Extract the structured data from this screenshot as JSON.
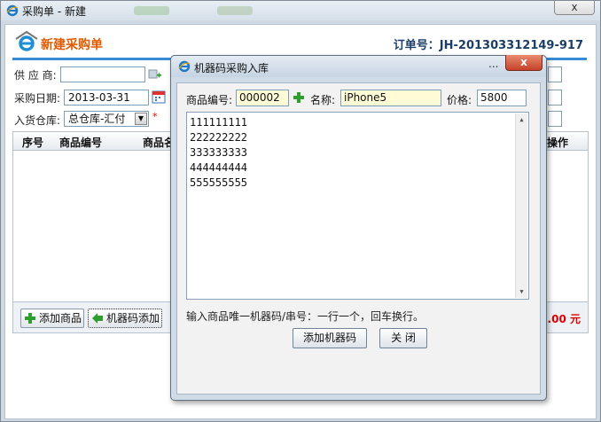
{
  "window": {
    "title": "采购单 - 新建",
    "close_glyph": "x"
  },
  "header": {
    "title": "新建采购单",
    "order_label": "订单号：JH-201303312149-917"
  },
  "form": {
    "supplier_label": "供 应 商:",
    "supplier_value": "",
    "date_label": "采购日期:",
    "date_value": "2013-03-31",
    "warehouse_label": "入货仓库:",
    "warehouse_value": "总仓库-汇付",
    "required_mark": "*"
  },
  "grid": {
    "columns": [
      "序号",
      "商品编号",
      "商品名",
      "操作"
    ]
  },
  "footer": {
    "add_product_button": "添加商品",
    "machine_code_button": "机器码添加",
    "total_text": "0.00 元"
  },
  "modal": {
    "title": "机器码采购入库",
    "minimize_glyph": "...",
    "close_glyph": "x",
    "product_code_label": "商品编号:",
    "product_code_value": "000002",
    "name_label": "名称:",
    "name_value": "iPhone5",
    "price_label": "价格:",
    "price_value": "5800",
    "codes": [
      "111111111",
      "222222222",
      "333333333",
      "444444444",
      "555555555"
    ],
    "hint": "输入商品唯一机器码/串号：一行一个，回车换行。",
    "add_button": "添加机器码",
    "close_button": "关 闭"
  },
  "icons": {
    "window": "ie-logo-icon",
    "header": "ie-logo-icon",
    "supplier_picker": "lookup-add-icon",
    "calendar": "calendar-icon",
    "product_add": "green-plus-icon",
    "add_product": "green-plus-icon",
    "machine_code": "green-arrow-icon"
  },
  "colors": {
    "header_title": "#e05a00",
    "order_label": "#1c3e66",
    "accent_rule": "#3a8bd6",
    "modal_close": "#c5432a"
  }
}
